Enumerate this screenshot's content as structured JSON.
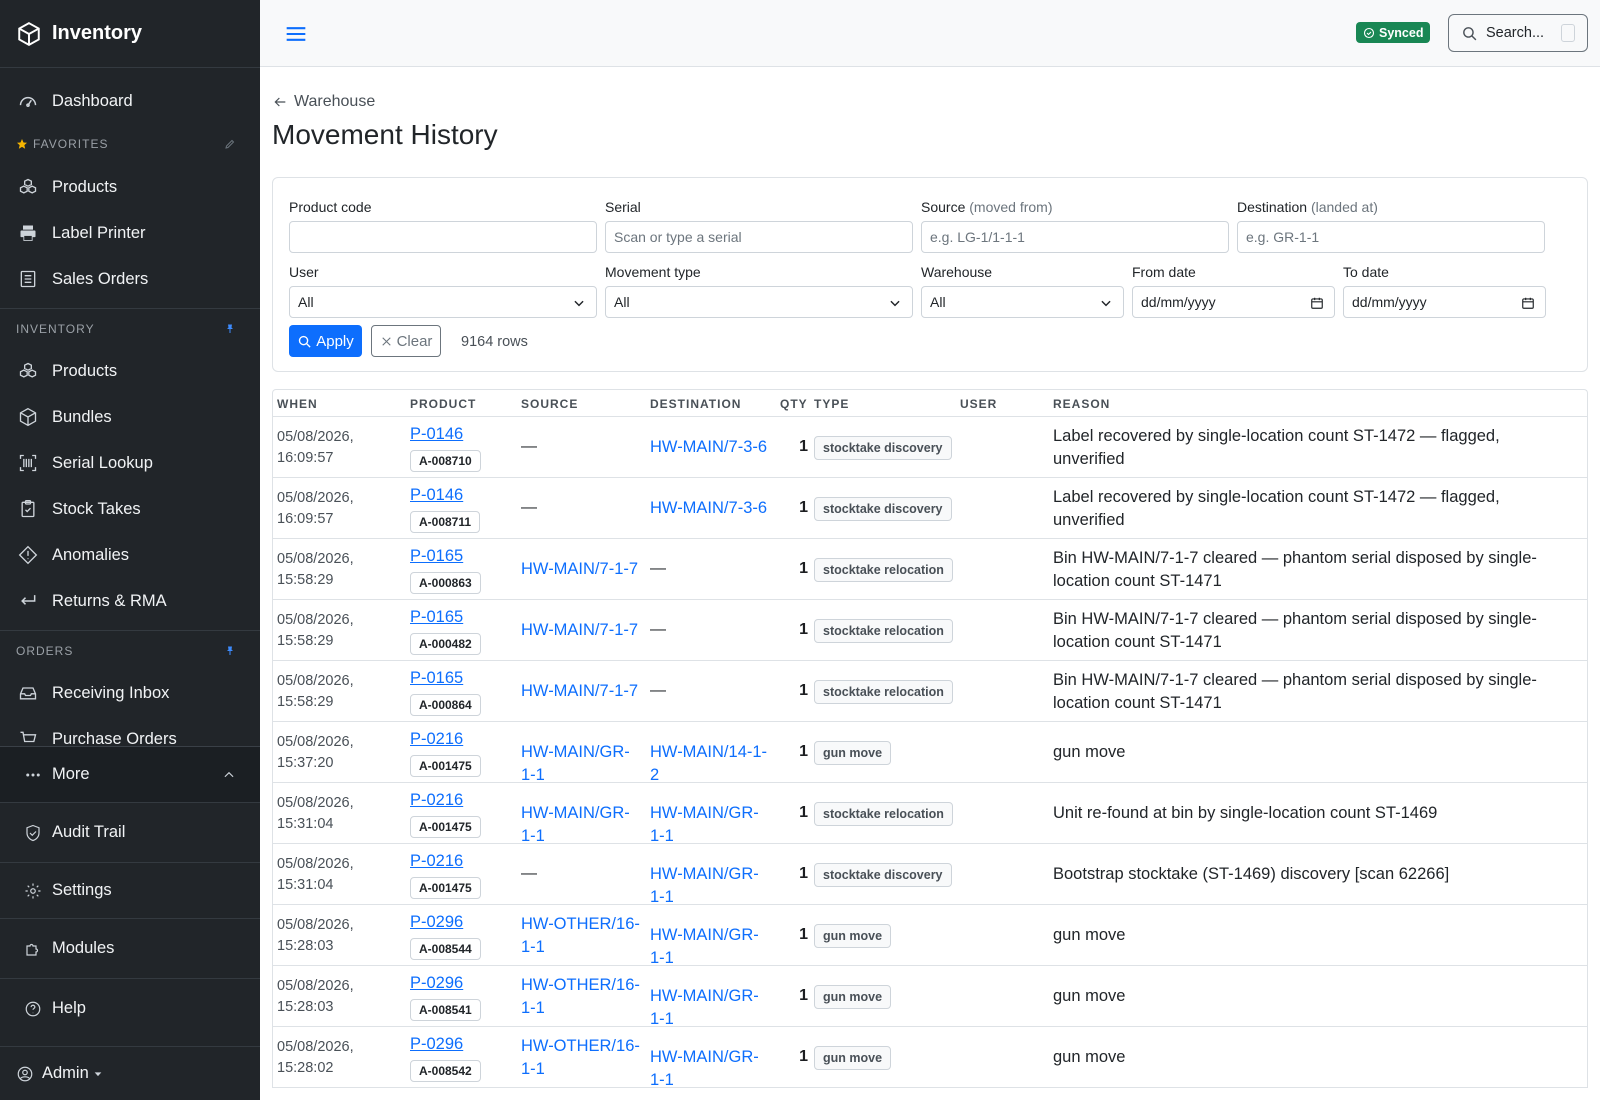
{
  "app": {
    "title": "Inventory"
  },
  "sidebar": {
    "top_items": [
      {
        "label": "Dashboard",
        "icon": "dashboard-icon"
      }
    ],
    "favorites": {
      "title": "FAVORITES",
      "items": [
        {
          "label": "Products",
          "icon": "products-icon"
        },
        {
          "label": "Label Printer",
          "icon": "printer-icon"
        },
        {
          "label": "Sales Orders",
          "icon": "sales-orders-icon"
        }
      ]
    },
    "inventory": {
      "title": "INVENTORY",
      "items": [
        {
          "label": "Products",
          "icon": "products-icon"
        },
        {
          "label": "Bundles",
          "icon": "bundle-icon"
        },
        {
          "label": "Serial Lookup",
          "icon": "barcode-icon"
        },
        {
          "label": "Stock Takes",
          "icon": "clipboard-icon"
        },
        {
          "label": "Anomalies",
          "icon": "diamond-alert-icon"
        },
        {
          "label": "Returns & RMA",
          "icon": "return-icon"
        }
      ]
    },
    "orders": {
      "title": "ORDERS",
      "items": [
        {
          "label": "Receiving Inbox",
          "icon": "inbox-icon"
        },
        {
          "label": "Purchase Orders",
          "icon": "cart-icon"
        }
      ]
    },
    "more_label": "More",
    "bottom_items": [
      {
        "label": "Audit Trail",
        "icon": "shield-icon"
      },
      {
        "label": "Settings",
        "icon": "gear-icon"
      },
      {
        "label": "Modules",
        "icon": "puzzle-icon"
      },
      {
        "label": "Help",
        "icon": "help-icon"
      }
    ],
    "user_label": "Admin"
  },
  "topbar": {
    "synced_label": "Synced",
    "search_placeholder": "Search..."
  },
  "page": {
    "back_label": "Warehouse",
    "title": "Movement History"
  },
  "filters": {
    "product_code": {
      "label": "Product code",
      "value": ""
    },
    "serial": {
      "label": "Serial",
      "placeholder": "Scan or type a serial"
    },
    "source": {
      "label": "Source",
      "hint": "(moved from)",
      "placeholder": "e.g. LG-1/1-1-1"
    },
    "destination": {
      "label": "Destination",
      "hint": "(landed at)",
      "placeholder": "e.g. GR-1-1"
    },
    "user": {
      "label": "User",
      "value": "All"
    },
    "movement_type": {
      "label": "Movement type",
      "value": "All"
    },
    "warehouse": {
      "label": "Warehouse",
      "value": "All"
    },
    "from_date": {
      "label": "From date",
      "placeholder": "dd/mm/yyyy"
    },
    "to_date": {
      "label": "To date",
      "placeholder": "dd/mm/yyyy"
    },
    "apply_label": "Apply",
    "clear_label": "Clear",
    "row_count": "9164 rows"
  },
  "table": {
    "headers": {
      "when": "WHEN",
      "product": "PRODUCT",
      "source": "SOURCE",
      "destination": "DESTINATION",
      "qty": "QTY",
      "type": "TYPE",
      "user": "USER",
      "reason": "REASON"
    },
    "rows": [
      {
        "when": "05/08/2026, 16:09:57",
        "product": "P-0146",
        "serial": "A-008710",
        "source": "—",
        "destination": "HW-MAIN/7-3-6",
        "qty": "1",
        "type": "stocktake discovery",
        "user": "",
        "reason": "Label recovered by single-location count ST-1472 — flagged, unverified"
      },
      {
        "when": "05/08/2026, 16:09:57",
        "product": "P-0146",
        "serial": "A-008711",
        "source": "—",
        "destination": "HW-MAIN/7-3-6",
        "qty": "1",
        "type": "stocktake discovery",
        "user": "",
        "reason": "Label recovered by single-location count ST-1472 — flagged, unverified"
      },
      {
        "when": "05/08/2026, 15:58:29",
        "product": "P-0165",
        "serial": "A-000863",
        "source": "HW-MAIN/7-1-7",
        "destination": "—",
        "qty": "1",
        "type": "stocktake relocation",
        "user": "",
        "reason": "Bin HW-MAIN/7-1-7 cleared — phantom serial disposed by single-location count ST-1471"
      },
      {
        "when": "05/08/2026, 15:58:29",
        "product": "P-0165",
        "serial": "A-000482",
        "source": "HW-MAIN/7-1-7",
        "destination": "—",
        "qty": "1",
        "type": "stocktake relocation",
        "user": "",
        "reason": "Bin HW-MAIN/7-1-7 cleared — phantom serial disposed by single-location count ST-1471"
      },
      {
        "when": "05/08/2026, 15:58:29",
        "product": "P-0165",
        "serial": "A-000864",
        "source": "HW-MAIN/7-1-7",
        "destination": "—",
        "qty": "1",
        "type": "stocktake relocation",
        "user": "",
        "reason": "Bin HW-MAIN/7-1-7 cleared — phantom serial disposed by single-location count ST-1471"
      },
      {
        "when": "05/08/2026, 15:37:20",
        "product": "P-0216",
        "serial": "A-001475",
        "source": "HW-MAIN/GR-1-1",
        "destination": "HW-MAIN/14-1-2",
        "qty": "1",
        "type": "gun move",
        "user": "",
        "reason": "gun move"
      },
      {
        "when": "05/08/2026, 15:31:04",
        "product": "P-0216",
        "serial": "A-001475",
        "source": "HW-MAIN/GR-1-1",
        "destination": "HW-MAIN/GR-1-1",
        "qty": "1",
        "type": "stocktake relocation",
        "user": "",
        "reason": "Unit re-found at bin by single-location count ST-1469"
      },
      {
        "when": "05/08/2026, 15:31:04",
        "product": "P-0216",
        "serial": "A-001475",
        "source": "—",
        "destination": "HW-MAIN/GR-1-1",
        "qty": "1",
        "type": "stocktake discovery",
        "user": "",
        "reason": "Bootstrap stocktake (ST-1469) discovery [scan 62266]"
      },
      {
        "when": "05/08/2026, 15:28:03",
        "product": "P-0296",
        "serial": "A-008544",
        "source": "HW-OTHER/16-1-1",
        "destination": "HW-MAIN/GR-1-1",
        "qty": "1",
        "type": "gun move",
        "user": "",
        "reason": "gun move"
      },
      {
        "when": "05/08/2026, 15:28:03",
        "product": "P-0296",
        "serial": "A-008541",
        "source": "HW-OTHER/16-1-1",
        "destination": "HW-MAIN/GR-1-1",
        "qty": "1",
        "type": "gun move",
        "user": "",
        "reason": "gun move"
      },
      {
        "when": "05/08/2026, 15:28:02",
        "product": "P-0296",
        "serial": "A-008542",
        "source": "HW-OTHER/16-1-1",
        "destination": "HW-MAIN/GR-1-1",
        "qty": "1",
        "type": "gun move",
        "user": "",
        "reason": "gun move"
      }
    ]
  }
}
